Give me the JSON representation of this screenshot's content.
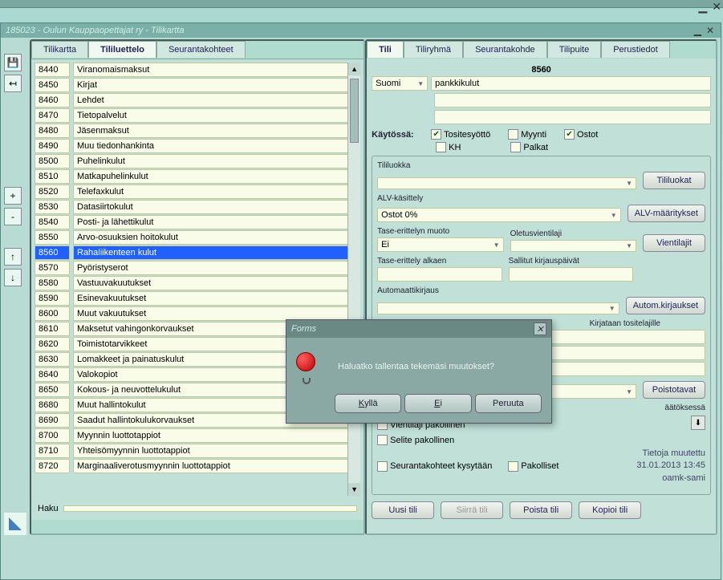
{
  "window": {
    "title": "185023 - Oulun Kauppaopettajat ry - Tilikartta"
  },
  "tabs_left": {
    "t1": "Tilikartta",
    "t2": "Tililuettelo",
    "t3": "Seurantakohteet"
  },
  "tabs_right": {
    "t1": "Tili",
    "t2": "Tiliryhmä",
    "t3": "Seurantakohde",
    "t4": "Tilipuite",
    "t5": "Perustiedot"
  },
  "accounts": [
    {
      "code": "8440",
      "name": "Viranomaismaksut"
    },
    {
      "code": "8450",
      "name": "Kirjat"
    },
    {
      "code": "8460",
      "name": "Lehdet"
    },
    {
      "code": "8470",
      "name": "Tietopalvelut"
    },
    {
      "code": "8480",
      "name": "Jäsenmaksut"
    },
    {
      "code": "8490",
      "name": "Muu tiedonhankinta"
    },
    {
      "code": "8500",
      "name": "Puhelinkulut"
    },
    {
      "code": "8510",
      "name": "Matkapuhelinkulut"
    },
    {
      "code": "8520",
      "name": "Telefaxkulut"
    },
    {
      "code": "8530",
      "name": "Datasiirtokulut"
    },
    {
      "code": "8540",
      "name": "Posti- ja lähettikulut"
    },
    {
      "code": "8550",
      "name": "Arvo-osuuksien hoitokulut"
    },
    {
      "code": "8560",
      "name": "Rahaliikenteen kulut"
    },
    {
      "code": "8570",
      "name": "Pyöristyserot"
    },
    {
      "code": "8580",
      "name": "Vastuuvakuutukset"
    },
    {
      "code": "8590",
      "name": "Esinevakuutukset"
    },
    {
      "code": "8600",
      "name": "Muut vakuutukset"
    },
    {
      "code": "8610",
      "name": "Maksetut vahingonkorvaukset"
    },
    {
      "code": "8620",
      "name": "Toimistotarvikkeet"
    },
    {
      "code": "8630",
      "name": "Lomakkeet ja painatuskulut"
    },
    {
      "code": "8640",
      "name": "Valokopiot"
    },
    {
      "code": "8650",
      "name": "Kokous- ja neuvottelukulut"
    },
    {
      "code": "8680",
      "name": "Muut hallintokulut"
    },
    {
      "code": "8690",
      "name": "Saadut hallintokulukorvaukset"
    },
    {
      "code": "8700",
      "name": "Myynnin luottotappiot"
    },
    {
      "code": "8710",
      "name": "Yhteisömyynnin luottotappiot"
    },
    {
      "code": "8720",
      "name": "Marginaaliverotusmyynnin luottotappiot"
    }
  ],
  "selected_code": "8560",
  "search_label": "Haku",
  "detail": {
    "code": "8560",
    "lang": "Suomi",
    "name": "pankkikulut",
    "inuse_label": "Käytössä:",
    "cb_tositesyotto": "Tositesyöttö",
    "cb_myynti": "Myynti",
    "cb_ostot": "Ostot",
    "cb_kh": "KH",
    "cb_palkat": "Palkat",
    "tililuokka_label": "Tililuokka",
    "btn_tililuokat": "Tililuokat",
    "alv_label": "ALV-käsittely",
    "alv_value": "Ostot 0%",
    "btn_alv": "ALV-määritykset",
    "tase_muoto_label": "Tase-erittelyn muoto",
    "tase_muoto_value": "Ei",
    "oletus_label": "Oletusvientilaji",
    "btn_vientilajit": "Vientilajit",
    "tase_alkaen_label": "Tase-erittely alkaen",
    "sallitut_label": "Sallitut kirjauspäivät",
    "autokirjaus_label": "Automaattikirjaus",
    "btn_autokirjaukset": "Autom.kirjaukset",
    "kirjataan_label": "Kirjataan tositelajille",
    "btn_poistotavat": "Poistotavat",
    "paatoksessa_suffix": "äätöksessä",
    "cb_vientilaji_pak": "Vientilaji pakollinen",
    "cb_selite_pak": "Selite pakollinen",
    "cb_seuranta_kys": "Seurantakohteet kysytään",
    "cb_pakolliset": "Pakolliset",
    "info_l1": "Tietoja muutettu",
    "info_l2": "31.01.2013 13:45",
    "info_l3": "oamk-sami",
    "btn_uusi": "Uusi tili",
    "btn_siirra": "Siirrä tili",
    "btn_poista": "Poista tili",
    "btn_kopioi": "Kopioi tili"
  },
  "dialog": {
    "title": "Forms",
    "message": "Haluatko tallentaa tekemäsi muutokset?",
    "btn_yes": "Kyllä",
    "btn_no": "Ei",
    "btn_cancel": "Peruuta"
  }
}
